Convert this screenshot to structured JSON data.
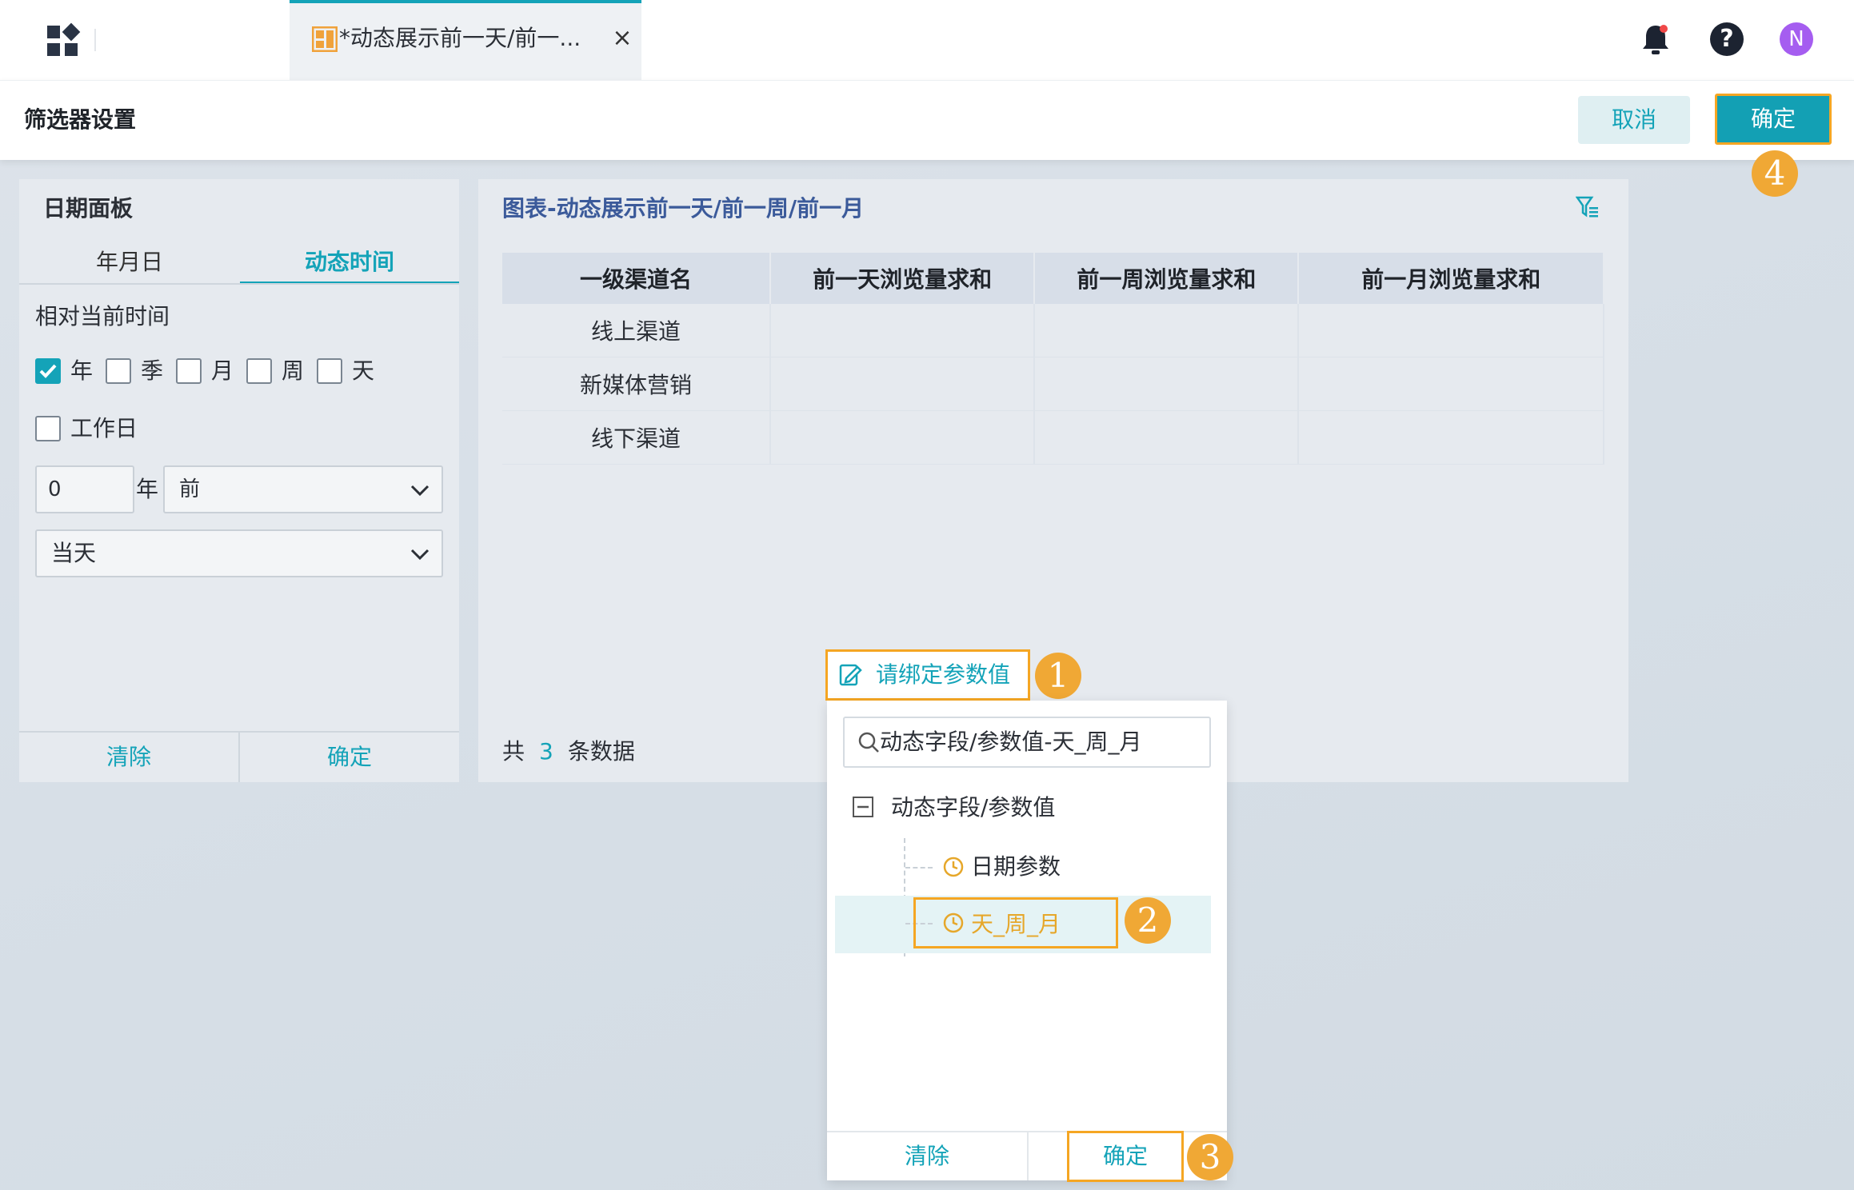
{
  "topbar": {
    "tab_title": "*动态展示前一天/前一...",
    "tab_close": "×",
    "help_glyph": "?",
    "avatar_initial": "N"
  },
  "filter_settings": {
    "title": "筛选器设置",
    "cancel_label": "取消",
    "ok_label": "确定"
  },
  "date_panel": {
    "title": "日期面板",
    "tabs": [
      {
        "label": "年月日",
        "active": false
      },
      {
        "label": "动态时间",
        "active": true
      }
    ],
    "relative_label": "相对当前时间",
    "units": [
      {
        "label": "年",
        "checked": true
      },
      {
        "label": "季",
        "checked": false
      },
      {
        "label": "月",
        "checked": false
      },
      {
        "label": "周",
        "checked": false
      },
      {
        "label": "天",
        "checked": false
      }
    ],
    "workday_label": "工作日",
    "workday_checked": false,
    "offset_value": "0",
    "offset_unit": "年",
    "direction": "前",
    "anchor": "当天",
    "clear_label": "清除",
    "ok_label": "确定"
  },
  "chart_panel": {
    "title": "图表-动态展示前一天/前一周/前一月",
    "columns": [
      "一级渠道名",
      "前一天浏览量求和",
      "前一周浏览量求和",
      "前一月浏览量求和"
    ],
    "rows": [
      [
        "线上渠道",
        "",
        "",
        ""
      ],
      [
        "新媒体营销",
        "",
        "",
        ""
      ],
      [
        "线下渠道",
        "",
        "",
        ""
      ]
    ],
    "count_prefix": "共",
    "count_value": "3",
    "count_suffix": "条数据"
  },
  "bind_popup": {
    "button_label": "请绑定参数值",
    "search_value": "动态字段/参数值-天_周_月",
    "tree_root": "动态字段/参数值",
    "tree_items": [
      {
        "label": "日期参数",
        "selected": false
      },
      {
        "label": "天_周_月",
        "selected": true
      }
    ],
    "clear_label": "清除",
    "ok_label": "确定"
  },
  "step_markers": [
    "1",
    "2",
    "3",
    "4"
  ],
  "colors": {
    "accent": "#14a3b8",
    "highlight": "#f5a623",
    "marker": "#f0a835",
    "avatar": "#a55df0"
  }
}
